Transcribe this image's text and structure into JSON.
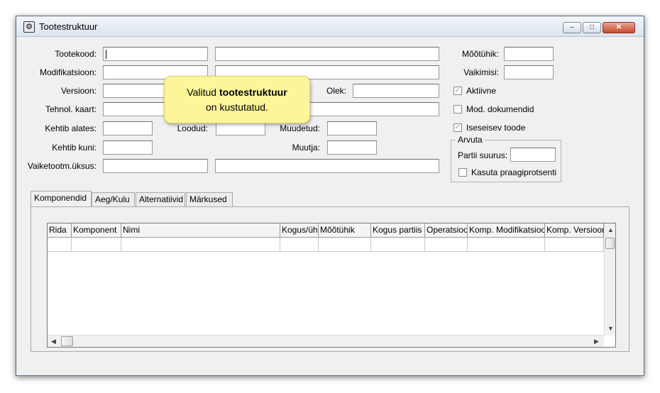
{
  "window": {
    "title": "Tootestruktuur",
    "icon": "gear-icon",
    "minimize_label": "–",
    "maximize_label": "□",
    "close_label": "✕"
  },
  "form": {
    "tootekood_label": "Tootekood:",
    "modifikatsioon_label": "Modifikatsioon:",
    "versioon_label": "Versioon:",
    "tehnol_kaart_label": "Tehnol. kaart:",
    "kehtib_alates_label": "Kehtib alates:",
    "kehtib_kuni_label": "Kehtib kuni:",
    "vaiketootm_label": "Vaiketootm.üksus:",
    "loodud_label": "Loodud:",
    "muudetud_label": "Muudetud:",
    "muutja_label": "Muutja:",
    "olek_label": "Olek:",
    "mootuhik_label": "Mõõtühik:",
    "vaikimisi_label": "Vaikimisi:"
  },
  "checkboxes": {
    "aktiivne": {
      "label": "Aktiivne",
      "checked": true
    },
    "mod_dokumendid": {
      "label": "Mod. dokumendid",
      "checked": false
    },
    "iseseisev_toode": {
      "label": "Iseseisev toode",
      "checked": true
    }
  },
  "arvuta": {
    "title": "Arvuta",
    "partii_suurus_label": "Partii suurus:",
    "kasuta_praagiprotsenti_label": "Kasuta praagiprotsenti"
  },
  "tooltip": {
    "line1_prefix": "Valitud ",
    "line1_bold": "tootestruktuur",
    "line2": "on kustutatud."
  },
  "tabs": [
    "Komponendid",
    "Aeg/Kulu",
    "Alternatiivid",
    "Märkused"
  ],
  "grid": {
    "columns": [
      "Rida",
      "Komponent",
      "Nimi",
      "Kogus/üh",
      "Mõõtühik",
      "Kogus partiis",
      "Operatsioon",
      "Komp. Modifikatsioon",
      "Komp. Versioon"
    ]
  }
}
